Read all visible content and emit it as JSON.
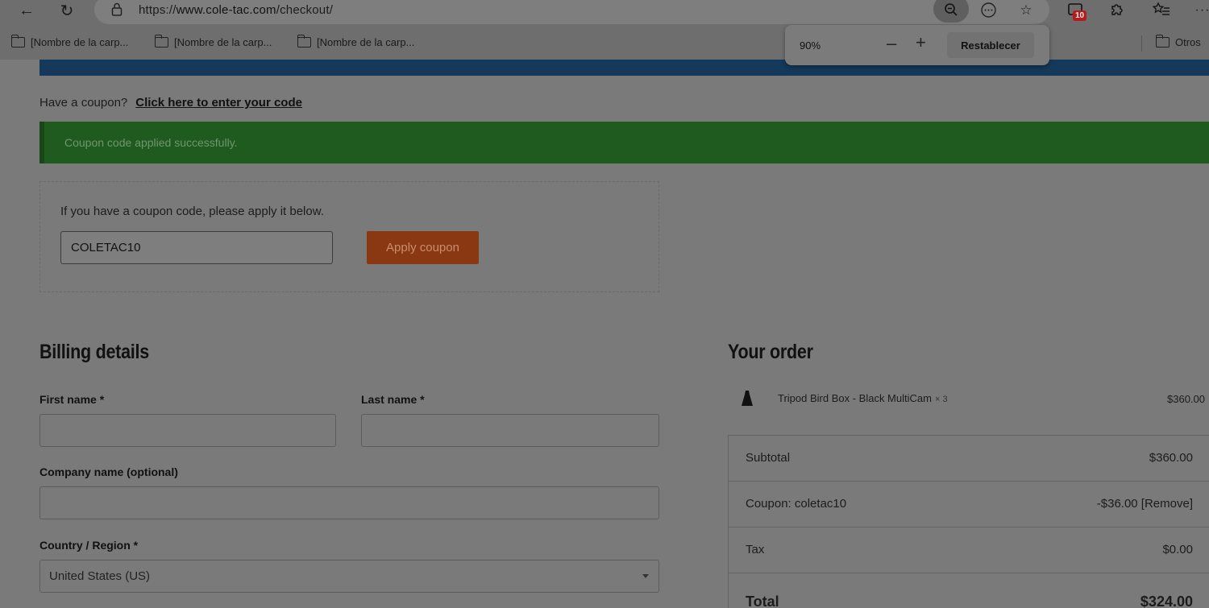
{
  "browser": {
    "url_prefix": "https://",
    "url_host": "www.cole-tac.com",
    "url_path": "/checkout/",
    "notification_count": "10",
    "bookmarks": [
      "[Nombre de la carp...",
      "[Nombre de la carp...",
      "[Nombre de la carp..."
    ],
    "other_bookmarks": "Otros",
    "zoom": {
      "value": "90%",
      "reset_label": "Restablecer"
    }
  },
  "coupon": {
    "prompt": "Have a coupon?",
    "link": "Click here to enter your code",
    "success_message": "Coupon code applied successfully.",
    "hint": "If you have a coupon code, please apply it below.",
    "code_value": "COLETAC10",
    "apply_label": "Apply coupon"
  },
  "billing": {
    "title": "Billing details",
    "first_name_label": "First name *",
    "last_name_label": "Last name *",
    "company_label": "Company name (optional)",
    "country_label": "Country / Region *",
    "country_value": "United States (US)"
  },
  "order": {
    "title": "Your order",
    "item_name": "Tripod Bird Box - Black MultiCam",
    "item_qty": "× 3",
    "item_price": "$360.00",
    "rows": [
      {
        "label": "Subtotal",
        "value": "$360.00"
      },
      {
        "label": "Coupon: coletac10",
        "value": "-$36.00 [Remove]"
      },
      {
        "label": "Tax",
        "value": "$0.00"
      }
    ],
    "total_label": "Total",
    "total_value": "$324.00"
  }
}
